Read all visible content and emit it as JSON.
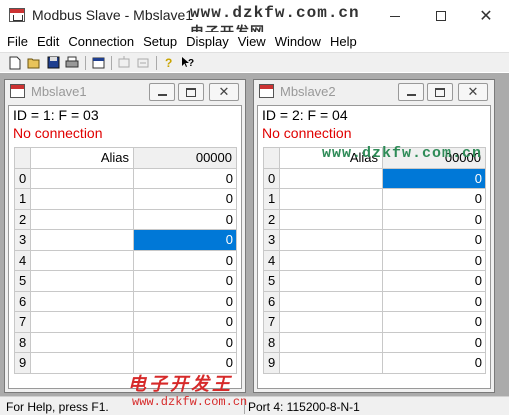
{
  "window": {
    "title": "Modbus Slave - Mbslave1",
    "minimize": "—",
    "maximize": "☐",
    "close": "✕"
  },
  "watermarks": {
    "top_url": "www.dzkfw.com.cn",
    "top_cn": "电子开发网",
    "mid_url": "www.dzkfw.com.cn",
    "bottom_cn": "电子开发王",
    "bottom_url": "www.dzkfw.com.cn"
  },
  "menu": [
    "File",
    "Edit",
    "Connection",
    "Setup",
    "Display",
    "View",
    "Window",
    "Help"
  ],
  "toolbar": {
    "icons": [
      "new-icon",
      "open-icon",
      "save-icon",
      "print-icon",
      "window-icon",
      "connect-icon",
      "disconnect-icon",
      "help-icon",
      "context-help-icon"
    ]
  },
  "children": [
    {
      "title": "Mbslave1",
      "id_line": "ID = 1: F = 03",
      "connection": "No connection",
      "alias_header": "Alias",
      "value_header": "00000",
      "selected_row": 3,
      "rows": [
        {
          "index": "0",
          "value": "0"
        },
        {
          "index": "1",
          "value": "0"
        },
        {
          "index": "2",
          "value": "0"
        },
        {
          "index": "3",
          "value": "0"
        },
        {
          "index": "4",
          "value": "0"
        },
        {
          "index": "5",
          "value": "0"
        },
        {
          "index": "6",
          "value": "0"
        },
        {
          "index": "7",
          "value": "0"
        },
        {
          "index": "8",
          "value": "0"
        },
        {
          "index": "9",
          "value": "0"
        }
      ]
    },
    {
      "title": "Mbslave2",
      "id_line": "ID = 2: F = 04",
      "connection": "No connection",
      "alias_header": "Alias",
      "value_header": "00000",
      "selected_row": 0,
      "rows": [
        {
          "index": "0",
          "value": "0"
        },
        {
          "index": "1",
          "value": "0"
        },
        {
          "index": "2",
          "value": "0"
        },
        {
          "index": "3",
          "value": "0"
        },
        {
          "index": "4",
          "value": "0"
        },
        {
          "index": "5",
          "value": "0"
        },
        {
          "index": "6",
          "value": "0"
        },
        {
          "index": "7",
          "value": "0"
        },
        {
          "index": "8",
          "value": "0"
        },
        {
          "index": "9",
          "value": "0"
        }
      ]
    }
  ],
  "status": {
    "help": "For Help, press F1.",
    "port": "Port 4: 115200-8-N-1"
  },
  "colors": {
    "selection": "#0078d7",
    "error_text": "#e00000",
    "mdi_background": "#ababab"
  }
}
